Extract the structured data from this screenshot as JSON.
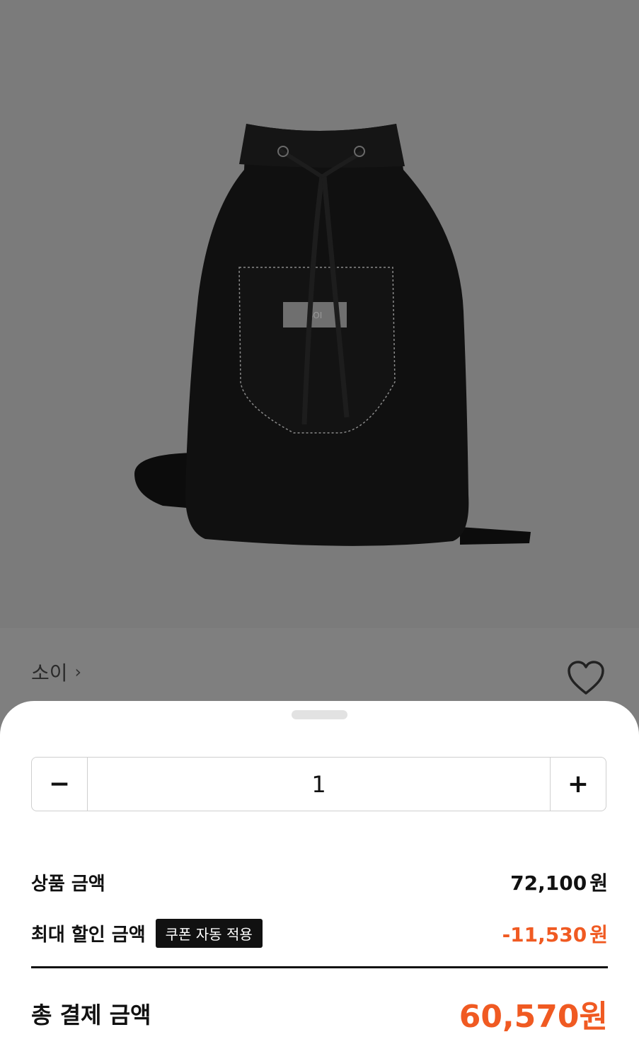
{
  "product": {
    "brand": "소이",
    "brand_chevron": "›",
    "image_description_icon": "backpack-image",
    "wishlist_icon": "heart-outline-icon",
    "bag_label": "SOI"
  },
  "quantity": {
    "minus_label": "−",
    "value": "1",
    "plus_label": "+"
  },
  "summary": {
    "product_amount_label": "상품 금액",
    "product_amount_value": "72,100",
    "product_amount_unit": "원",
    "max_discount_label": "최대 할인 금액",
    "coupon_badge": "쿠폰 자동 적용",
    "max_discount_value": "-11,530",
    "max_discount_unit": "원",
    "total_label": "총 결제 금액",
    "total_value": "60,570원"
  },
  "colors": {
    "accent": "#f05a22",
    "overlay": "#7f7f7f"
  }
}
